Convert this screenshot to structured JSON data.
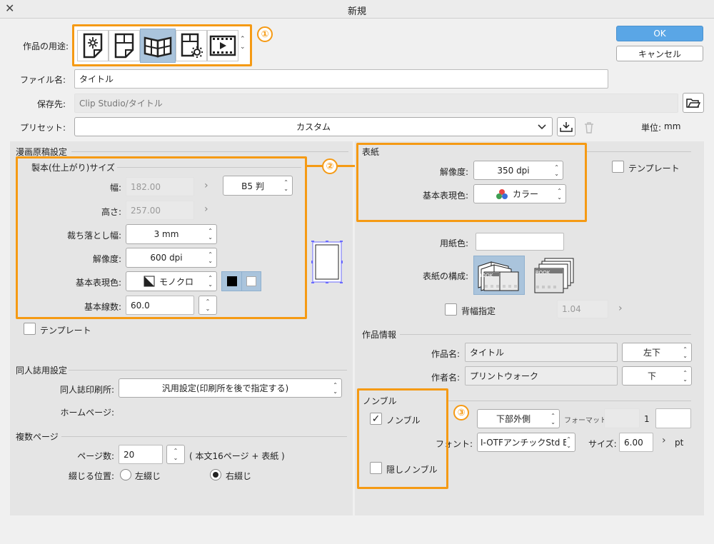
{
  "window": {
    "title": "新規",
    "close": "✕"
  },
  "dialog": {
    "ok": "OK",
    "cancel": "キャンセル"
  },
  "top": {
    "usage_label": "作品の用途:",
    "filename_label": "ファイル名:",
    "filename": "タイトル",
    "save_label": "保存先:",
    "save_path": "Clip Studio/タイトル",
    "preset_label": "プリセット:",
    "preset_value": "カスタム",
    "unit_label": "単位:",
    "unit_value": "mm"
  },
  "usage_icons": [
    "illustration-icon",
    "webtoon-icon",
    "comic-icon",
    "settings-page-icon",
    "animation-icon"
  ],
  "manga": {
    "section": "漫画原稿設定",
    "subsection": "製本(仕上がり)サイズ",
    "width_label": "幅:",
    "width": "182.00",
    "size_preset": "B5 判",
    "height_label": "高さ:",
    "height": "257.00",
    "bleed_label": "裁ち落とし幅:",
    "bleed": "3 mm",
    "res_label": "解像度:",
    "res": "600 dpi",
    "color_label": "基本表現色:",
    "color": "モノクロ",
    "lines_label": "基本線数:",
    "lines": "60.0",
    "template": "テンプレート"
  },
  "cover": {
    "section": "表紙",
    "res_label": "解像度:",
    "res": "350 dpi",
    "color_label": "基本表現色:",
    "color": "カラー",
    "template": "テンプレート",
    "paper_label": "用紙色:",
    "layout_label": "表紙の構成:",
    "book_text": "BOOK",
    "spine_label": "背幅指定",
    "spine": "1.04"
  },
  "doujin": {
    "section": "同人誌用設定",
    "printer_label": "同人誌印刷所:",
    "printer": "汎用設定(印刷所を後で指定する)",
    "homepage_label": "ホームページ:"
  },
  "pages": {
    "section": "複数ページ",
    "count_label": "ページ数:",
    "count": "20",
    "note": "( 本文16ページ + 表紙 )",
    "binding_label": "綴じる位置:",
    "left": "左綴じ",
    "right": "右綴じ"
  },
  "work": {
    "section": "作品情報",
    "title_label": "作品名:",
    "title": "タイトル",
    "title_pos": "左下",
    "author_label": "作者名:",
    "author": "プリントウォーク",
    "author_pos": "下"
  },
  "nombre": {
    "section": "ノンブル",
    "enable": "ノンブル",
    "position": "下部外側",
    "format_label": "フォーマット",
    "format_num": "1",
    "font_label": "フォント:",
    "font": "I-OTFアンチックStd B",
    "size_label": "サイズ:",
    "size": "6.00",
    "unit": "pt",
    "hidden": "隠しノンブル"
  },
  "callouts": [
    "①",
    "②",
    "③"
  ],
  "glyphs": {
    "updown": "⌃⌄",
    "right": "›",
    "check": "✓"
  },
  "colors": {
    "accent": "#f59a14",
    "ok": "#5aa6e6",
    "selected": "#aac4dc"
  }
}
